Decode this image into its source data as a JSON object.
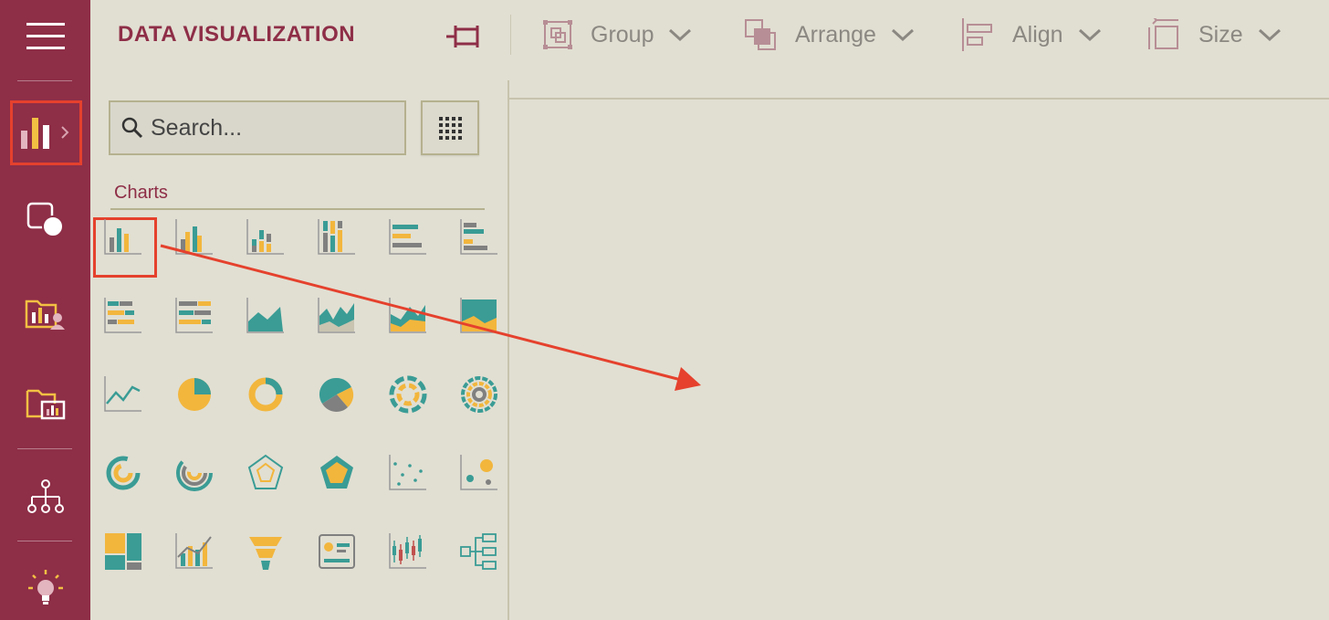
{
  "app": {
    "title": "DATA VISUALIZATION"
  },
  "toolbar": {
    "group_label": "Group",
    "arrange_label": "Arrange",
    "align_label": "Align",
    "size_label": "Size"
  },
  "rail": {
    "items": [
      {
        "icon": "hamburger-menu-icon"
      },
      {
        "icon": "bar-chart-icon",
        "active": true
      },
      {
        "icon": "shapes-icon"
      },
      {
        "icon": "folder-user-chart-icon"
      },
      {
        "icon": "folder-chart-icon"
      },
      {
        "icon": "hierarchy-icon"
      },
      {
        "icon": "lightbulb-icon"
      }
    ]
  },
  "search": {
    "placeholder": "Search..."
  },
  "section": {
    "label": "Charts"
  },
  "charts": [
    "column-chart-icon",
    "clustered-column-chart-icon",
    "stacked-column-chart-icon",
    "100-stacked-column-chart-icon",
    "bar-chart-icon",
    "clustered-bar-chart-icon",
    "stacked-bar-chart-icon",
    "100-stacked-bar-chart-icon",
    "area-chart-icon",
    "stacked-area-chart-icon",
    "100-stacked-area-chart-icon",
    "layered-area-chart-icon",
    "line-chart-icon",
    "pie-chart-icon",
    "donut-chart-icon",
    "rose-chart-icon",
    "multilevel-pie-chart-icon",
    "sunburst-chart-icon",
    "radial-bar-chart-icon",
    "radial-stacked-bar-chart-icon",
    "radar-chart-icon",
    "filled-radar-chart-icon",
    "scatter-chart-icon",
    "bubble-chart-icon",
    "treemap-chart-icon",
    "combo-chart-icon",
    "funnel-chart-icon",
    "kpi-card-icon",
    "candlestick-chart-icon",
    "org-tree-chart-icon"
  ],
  "colors": {
    "brand": "#8e2e47",
    "accent_teal": "#3a9c95",
    "accent_yellow": "#f2b63d",
    "accent_grey": "#808080",
    "highlight": "#e5412d"
  }
}
